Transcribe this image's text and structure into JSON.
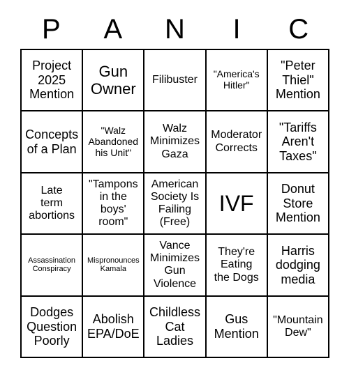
{
  "card": {
    "title_letters": [
      "P",
      "A",
      "N",
      "I",
      "C"
    ],
    "rows": [
      [
        {
          "text": "Project\n2025\nMention",
          "size": "l"
        },
        {
          "text": "Gun\nOwner",
          "size": "xl"
        },
        {
          "text": "Filibuster",
          "size": "m"
        },
        {
          "text": "\"America's\nHitler\"",
          "size": "s"
        },
        {
          "text": "\"Peter\nThiel\"\nMention",
          "size": "l"
        }
      ],
      [
        {
          "text": "Concepts\nof a Plan",
          "size": "l"
        },
        {
          "text": "\"Walz\nAbandoned\nhis Unit\"",
          "size": "s"
        },
        {
          "text": "Walz\nMinimizes\nGaza",
          "size": "m"
        },
        {
          "text": "Moderator\nCorrects",
          "size": "m"
        },
        {
          "text": "\"Tariffs\nAren't\nTaxes\"",
          "size": "l"
        }
      ],
      [
        {
          "text": "Late\nterm\nabortions",
          "size": "m"
        },
        {
          "text": "\"Tampons\nin the\nboys'\nroom\"",
          "size": "m"
        },
        {
          "text": "American\nSociety Is\nFailing\n(Free)",
          "size": "m"
        },
        {
          "text": "IVF",
          "size": "xxl"
        },
        {
          "text": "Donut\nStore\nMention",
          "size": "l"
        }
      ],
      [
        {
          "text": "Assassination\nConspiracy",
          "size": "xs"
        },
        {
          "text": "Mispronounces\nKamala",
          "size": "xs"
        },
        {
          "text": "Vance\nMinimizes\nGun\nViolence",
          "size": "m"
        },
        {
          "text": "They're\nEating\nthe Dogs",
          "size": "m"
        },
        {
          "text": "Harris\ndodging\nmedia",
          "size": "l"
        }
      ],
      [
        {
          "text": "Dodges\nQuestion\nPoorly",
          "size": "l"
        },
        {
          "text": "Abolish\nEPA/DoE",
          "size": "l"
        },
        {
          "text": "Childless\nCat\nLadies",
          "size": "l"
        },
        {
          "text": "Gus\nMention",
          "size": "l"
        },
        {
          "text": "\"Mountain\nDew\"",
          "size": "m"
        }
      ]
    ]
  }
}
